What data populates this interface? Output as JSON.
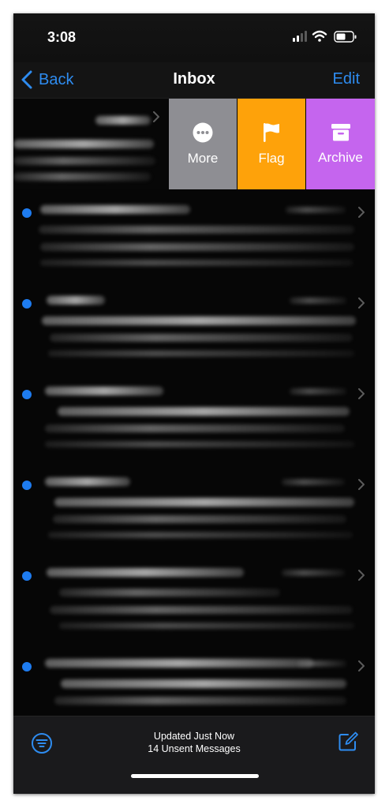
{
  "status_bar": {
    "time": "3:08",
    "icons": [
      "cellular-signal-icon",
      "wifi-icon",
      "battery-icon"
    ]
  },
  "nav": {
    "back_label": "Back",
    "title": "Inbox",
    "edit_label": "Edit"
  },
  "swipe_actions": [
    {
      "label": "More",
      "icon": "ellipsis-circle-icon",
      "color": "#8e8e93"
    },
    {
      "label": "Flag",
      "icon": "flag-icon",
      "color": "#fea20a"
    },
    {
      "label": "Archive",
      "icon": "archive-box-icon",
      "color": "#c565ee"
    }
  ],
  "messages": [
    {
      "unread": true,
      "redacted": true
    },
    {
      "unread": true,
      "redacted": true
    },
    {
      "unread": true,
      "redacted": true
    },
    {
      "unread": true,
      "redacted": true
    },
    {
      "unread": true,
      "redacted": true
    },
    {
      "unread": true,
      "redacted": true
    }
  ],
  "toolbar": {
    "status_line1": "Updated Just Now",
    "status_line2": "14 Unsent Messages",
    "filter_icon": "filter-circle-icon",
    "compose_icon": "compose-icon"
  },
  "colors": {
    "accent": "#2e8cf0",
    "unread_dot": "#1e7cf0",
    "background": "#000000"
  }
}
